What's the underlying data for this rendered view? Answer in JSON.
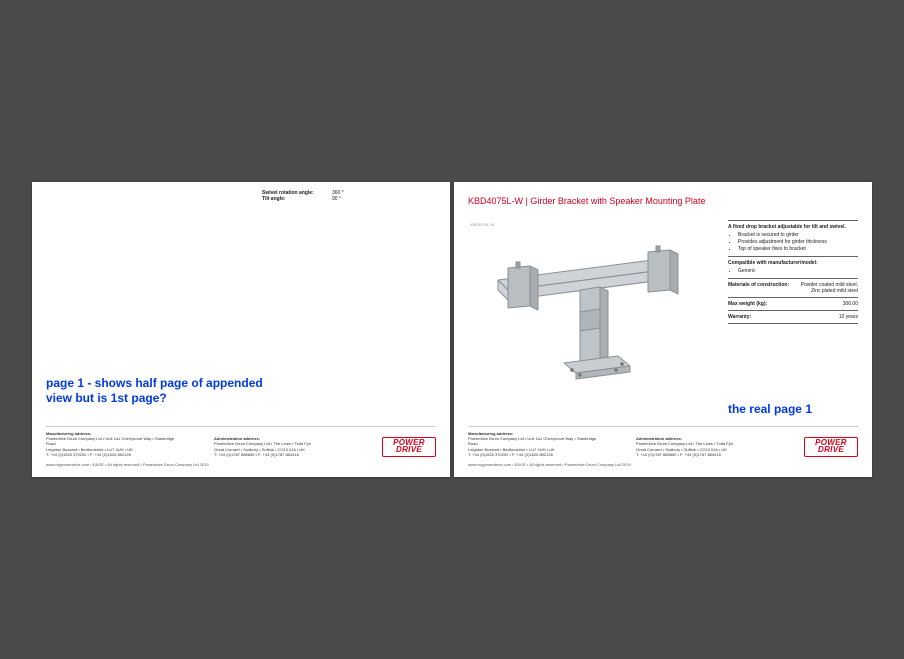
{
  "page1": {
    "specs": [
      {
        "label": "Swivel rotation angle:",
        "value": "360 °"
      },
      {
        "label": "Tilt angle:",
        "value": "90 °"
      }
    ],
    "footer": {
      "mfg_head": "Manufacturing address:",
      "mfg_line1": "Powerdrive Drum Company Ltd  •  Unit 1a1 Cherrycourt Way  •  Stanbridge Road",
      "mfg_line2": "Leighton Buzzard  •  Bedfordshire  •  LU7 4UH  •  UK",
      "mfg_line3": "T: +44 (0)1525 370292  •  F: +44 (0)1525 852126",
      "admin_head": "Administration address:",
      "admin_line1": "Powerdrive Drum Company Ltd  •  The Lines  •  Todd Fyn",
      "admin_line2": "Great Cornard  •  Sudbury  •  Suffolk  •  CO10 0JA  •  UK",
      "admin_line3": "T: +44 (0)1787 888650  •  F: +44 (0)1787 884416",
      "bottom": "www.mypowerdrive.com  •  E&OE  •  All rights reserved  •  Powerdrive Drum Company Ltd 2019"
    },
    "annotation": "page 1 - shows half page of appended\nview but is 1st page?"
  },
  "page2": {
    "title": "KBD4075L-W | Girder Bracket with Speaker Mounting Plate",
    "desc_head": "A fixed drop bracket adjustable for tilt and swivel.",
    "desc_bullets": [
      "Bracket is secured to girder",
      "Provides adjustment for girder thickness",
      "Top of speaker fixes to bracket"
    ],
    "compat_head": "Compatible with manufacturer/model:",
    "compat_bullets": [
      "Generic"
    ],
    "rows": [
      {
        "k": "Materials of construction:",
        "v": "Powder coated mild steel, Zinc plated mild steel"
      },
      {
        "k": "Max weight (kg):",
        "v": "300.00"
      },
      {
        "k": "Warranty:",
        "v": "10 years"
      }
    ],
    "drawing_label": "KBD4075L-W",
    "annotation": "the real page 1"
  },
  "logo": {
    "line1": "POWER",
    "line2": "DRIVE"
  }
}
